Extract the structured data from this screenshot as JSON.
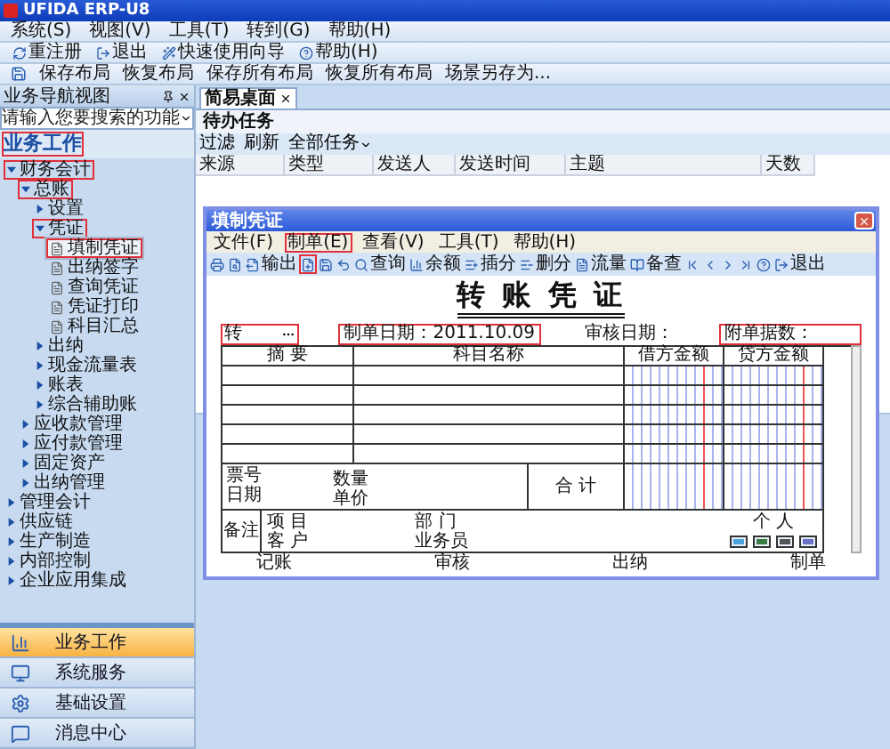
{
  "window": {
    "title": "UFIDA ERP-U8"
  },
  "menu": [
    "系统(S)",
    "视图(V)",
    "工具(T)",
    "转到(G)",
    "帮助(H)"
  ],
  "toolbar": [
    {
      "kind": "relogin",
      "label": "重注册"
    },
    {
      "kind": "exit",
      "label": "退出"
    },
    {
      "kind": "wizard",
      "label": "快速使用向导"
    },
    {
      "kind": "help",
      "label": "帮助(H)"
    }
  ],
  "layout_bar": [
    "保存布局",
    "恢复布局",
    "保存所有布局",
    "恢复所有布局",
    "场景另存为..."
  ],
  "sidebar": {
    "title": "业务导航视图",
    "search": {
      "placeholder": "请输入您要搜索的功能"
    },
    "section": {
      "label": "业务工作",
      "highlighted": true
    },
    "tree": [
      {
        "label": "财务会计",
        "kind": "folder",
        "expanded": true,
        "highlighted": true,
        "selected": false,
        "children": [
          {
            "label": "总账",
            "kind": "folder",
            "expanded": true,
            "highlighted": true,
            "selected": false,
            "children": [
              {
                "label": "设置",
                "kind": "folder",
                "expanded": false,
                "highlighted": false,
                "selected": false
              },
              {
                "label": "凭证",
                "kind": "folder",
                "expanded": true,
                "highlighted": true,
                "selected": false,
                "children": [
                  {
                    "label": "填制凭证",
                    "kind": "page",
                    "highlighted": true,
                    "selected": true
                  },
                  {
                    "label": "出纳签字",
                    "kind": "page",
                    "highlighted": false,
                    "selected": false
                  },
                  {
                    "label": "查询凭证",
                    "kind": "page",
                    "highlighted": false,
                    "selected": false
                  },
                  {
                    "label": "凭证打印",
                    "kind": "page",
                    "highlighted": false,
                    "selected": false
                  },
                  {
                    "label": "科目汇总",
                    "kind": "page",
                    "highlighted": false,
                    "selected": false
                  }
                ]
              },
              {
                "label": "出纳",
                "kind": "folder",
                "expanded": false,
                "highlighted": false,
                "selected": false
              },
              {
                "label": "现金流量表",
                "kind": "folder",
                "expanded": false,
                "highlighted": false,
                "selected": false
              },
              {
                "label": "账表",
                "kind": "folder",
                "expanded": false,
                "highlighted": false,
                "selected": false
              },
              {
                "label": "综合辅助账",
                "kind": "folder",
                "expanded": false,
                "highlighted": false,
                "selected": false
              }
            ]
          },
          {
            "label": "应收款管理",
            "kind": "folder",
            "expanded": false,
            "highlighted": false,
            "selected": false
          },
          {
            "label": "应付款管理",
            "kind": "folder",
            "expanded": false,
            "highlighted": false,
            "selected": false
          },
          {
            "label": "固定资产",
            "kind": "folder",
            "expanded": false,
            "highlighted": false,
            "selected": false
          },
          {
            "label": "出纳管理",
            "kind": "folder",
            "expanded": false,
            "highlighted": false,
            "selected": false
          }
        ]
      },
      {
        "label": "管理会计",
        "kind": "folder",
        "expanded": false,
        "highlighted": false,
        "selected": false
      },
      {
        "label": "供应链",
        "kind": "folder",
        "expanded": false,
        "highlighted": false,
        "selected": false
      },
      {
        "label": "生产制造",
        "kind": "folder",
        "expanded": false,
        "highlighted": false,
        "selected": false
      },
      {
        "label": "内部控制",
        "kind": "folder",
        "expanded": false,
        "highlighted": false,
        "selected": false
      },
      {
        "label": "企业应用集成",
        "kind": "folder",
        "expanded": false,
        "highlighted": false,
        "selected": false
      }
    ],
    "nav": [
      {
        "label": "业务工作",
        "selected": true
      },
      {
        "label": "系统服务",
        "selected": false
      },
      {
        "label": "基础设置",
        "selected": false
      },
      {
        "label": "消息中心",
        "selected": false
      }
    ]
  },
  "desktop": {
    "tab": "简易桌面",
    "panel_title": "待办任务",
    "actions": [
      {
        "label": "过滤",
        "kind": "plain"
      },
      {
        "label": "刷新",
        "kind": "plain"
      },
      {
        "label": "全部任务",
        "kind": "dropdown"
      }
    ],
    "columns": [
      "来源",
      "类型",
      "发送人",
      "发送时间",
      "主题",
      "天数"
    ]
  },
  "dialog": {
    "title": "填制凭证",
    "menu": [
      {
        "label": "文件(F)",
        "highlighted": false
      },
      {
        "label": "制单(E)",
        "highlighted": true
      },
      {
        "label": "查看(V)",
        "highlighted": false
      },
      {
        "label": "工具(T)",
        "highlighted": false
      },
      {
        "label": "帮助(H)",
        "highlighted": false
      }
    ],
    "toolbar": [
      {
        "kind": "print",
        "highlighted": false
      },
      {
        "kind": "preview",
        "highlighted": false
      },
      {
        "kind": "output",
        "label": "输出",
        "highlighted": false
      },
      {
        "kind": "new",
        "highlighted": true
      },
      {
        "kind": "save",
        "highlighted": false
      },
      {
        "kind": "undo",
        "highlighted": false
      },
      {
        "kind": "query",
        "label": "查询",
        "highlighted": false
      },
      {
        "kind": "balance",
        "label": "余额",
        "highlighted": false
      },
      {
        "kind": "insert",
        "label": "插分",
        "highlighted": false
      },
      {
        "kind": "delete",
        "label": "删分",
        "highlighted": false
      },
      {
        "kind": "flow",
        "label": "流量",
        "highlighted": false
      },
      {
        "kind": "reference",
        "label": "备查",
        "highlighted": false
      },
      {
        "kind": "first",
        "highlighted": false
      },
      {
        "kind": "prev",
        "highlighted": false
      },
      {
        "kind": "next",
        "highlighted": false
      },
      {
        "kind": "last",
        "highlighted": false
      },
      {
        "kind": "help",
        "highlighted": false
      },
      {
        "kind": "exit",
        "label": "退出",
        "highlighted": false
      }
    ],
    "voucher": {
      "title": "转 账 凭 证",
      "type_field": {
        "value": "转",
        "highlighted": true
      },
      "date": {
        "text": "制单日期：2011.10.09",
        "highlighted": true
      },
      "audit_date": {
        "text": "审核日期：",
        "highlighted": false
      },
      "attachments": {
        "text": "附单据数：",
        "highlighted": true
      },
      "columns": [
        "摘 要",
        "科目名称",
        "借方金额",
        "贷方金额"
      ],
      "footer": {
        "ticket": "票号",
        "date": "日期",
        "quantity": "数量",
        "price": "单价",
        "total": "合 计"
      },
      "remarks": {
        "label": "备注",
        "project": "项 目",
        "customer": "客 户",
        "department": "部 门",
        "salesman": "业务员",
        "person": "个 人"
      },
      "signatures": [
        "记账",
        "审核",
        "出纳",
        "制单"
      ]
    }
  }
}
